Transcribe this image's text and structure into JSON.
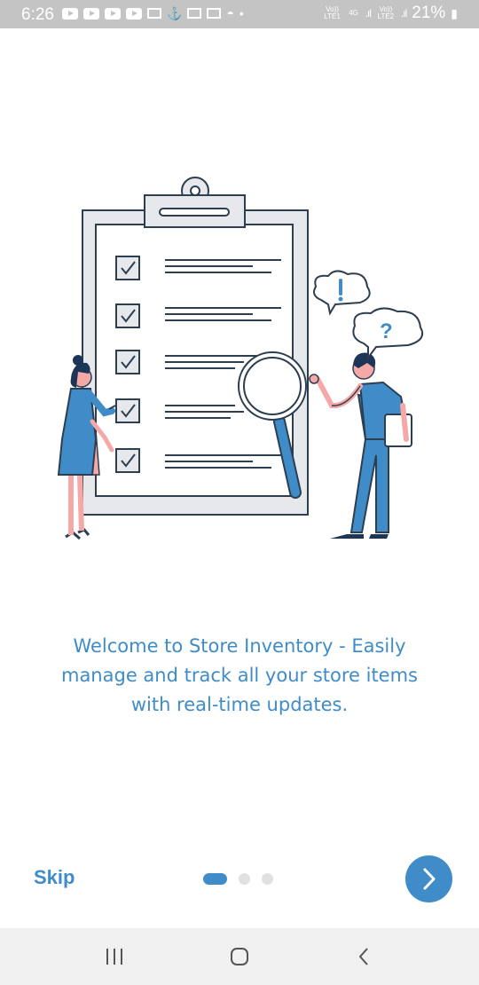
{
  "status_bar": {
    "time": "6:26",
    "battery": "21%",
    "network_labels": [
      "Vo)) LTE1",
      "4G",
      "Vo)) LTE2"
    ]
  },
  "illustration": {
    "icons": [
      "clipboard-checklist",
      "woman-with-pen",
      "magnifying-glass",
      "man-with-tablet",
      "exclamation-bubble",
      "question-bubble"
    ]
  },
  "onboarding": {
    "description_lines": [
      "Welcome to Store Inventory - Easily",
      "manage and track all your store items",
      "with real-time updates."
    ],
    "skip_label": "Skip",
    "total_pages": 3,
    "current_page": 1
  },
  "colors": {
    "accent": "#3f8cc8",
    "dot_inactive": "#e1e1e1",
    "status_bar": "#c4c4c4",
    "nav_bar": "#f0f0f0",
    "line_art": "#2c3e50"
  }
}
